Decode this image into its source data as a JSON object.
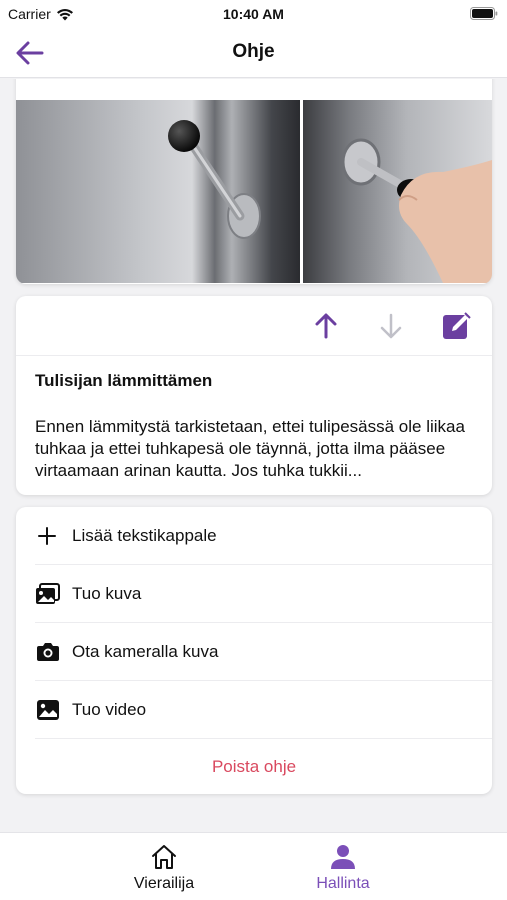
{
  "status_bar": {
    "carrier": "Carrier",
    "time": "10:40 AM"
  },
  "header": {
    "title": "Ohje"
  },
  "text_block": {
    "heading": "Tulisijan lämmittämen",
    "body": "Ennen lämmitystä tarkistetaan, ettei tulipesässä ole liikaa tuhkaa ja ettei tuhkapesä ole täynnä, jotta ilma pääsee virtaamaan arinan kautta. Jos tuhka tukkii..."
  },
  "actions_menu": {
    "items": [
      {
        "label": "Lisää tekstikappale",
        "icon": "plus-icon"
      },
      {
        "label": "Tuo kuva",
        "icon": "images-icon"
      },
      {
        "label": "Ota kameralla kuva",
        "icon": "camera-icon"
      },
      {
        "label": "Tuo video",
        "icon": "image-icon"
      }
    ],
    "delete_label": "Poista ohje"
  },
  "tabs": [
    {
      "label": "Vierailija",
      "icon": "home-icon",
      "active": false
    },
    {
      "label": "Hallinta",
      "icon": "person-icon",
      "active": true
    }
  ],
  "colors": {
    "accent": "#6b3fa0",
    "danger": "#d9495f",
    "disabled": "#c0c0c8"
  }
}
